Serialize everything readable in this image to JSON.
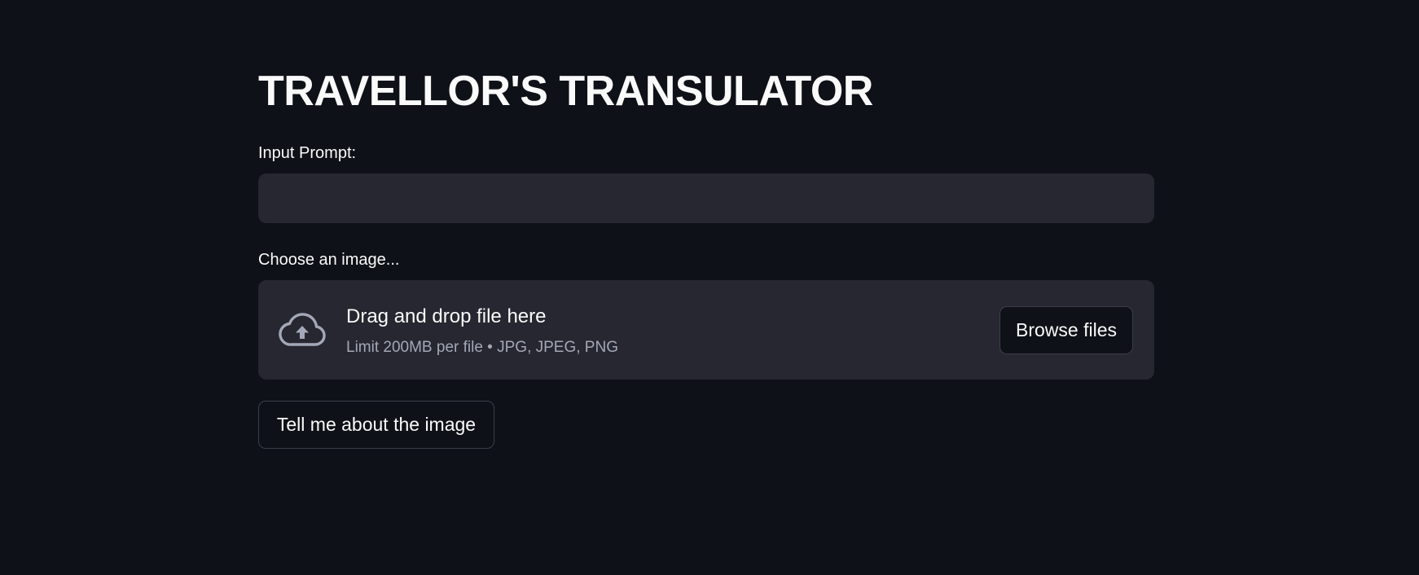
{
  "header": {
    "title": "TRAVELLOR'S TRANSULATOR"
  },
  "prompt": {
    "label": "Input Prompt:",
    "value": "",
    "placeholder": ""
  },
  "uploader": {
    "label": "Choose an image...",
    "drop_text": "Drag and drop file here",
    "limit_text": "Limit 200MB per file • JPG, JPEG, PNG",
    "browse_label": "Browse files",
    "icon": "cloud-upload-icon"
  },
  "actions": {
    "submit_label": "Tell me about the image"
  },
  "colors": {
    "background": "#0e1117",
    "surface": "#262730",
    "text": "#fafafa",
    "muted_text": "#a3a8b8",
    "border": "#3b3e4a"
  }
}
